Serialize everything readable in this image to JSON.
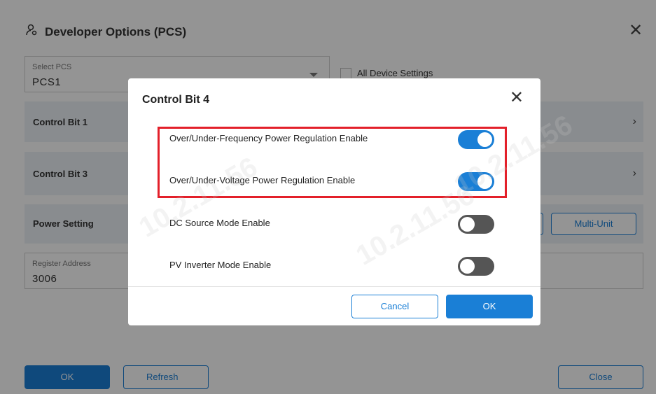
{
  "background": {
    "title": "Developer Options (PCS)",
    "title_icon": "user-gear-icon",
    "select_pcs": {
      "label": "Select PCS",
      "value": "PCS1"
    },
    "all_device_settings_label": "All Device Settings",
    "rows": [
      {
        "title": "Control Bit 1"
      },
      {
        "title": "Control Bit 3"
      },
      {
        "title": "Power Setting"
      }
    ],
    "multi_unit_label": "Multi-Unit",
    "register_address": {
      "label": "Register Address",
      "value": "3006"
    },
    "ok_label": "OK",
    "refresh_label": "Refresh",
    "close_label": "Close"
  },
  "modal": {
    "title": "Control Bit 4",
    "options": [
      {
        "label": "Over/Under-Frequency Power Regulation Enable",
        "enabled": true
      },
      {
        "label": "Over/Under-Voltage Power Regulation Enable",
        "enabled": true
      },
      {
        "label": "DC Source Mode Enable",
        "enabled": false
      },
      {
        "label": "PV Inverter Mode Enable",
        "enabled": false
      }
    ],
    "cancel_label": "Cancel",
    "ok_label": "OK"
  },
  "watermarks": [
    "10.2.11.56",
    "10.2.11.56",
    "10.2.11.56"
  ],
  "colors": {
    "accent": "#1a7fd6",
    "highlight": "#e3202a",
    "toggle_off": "#555555"
  }
}
